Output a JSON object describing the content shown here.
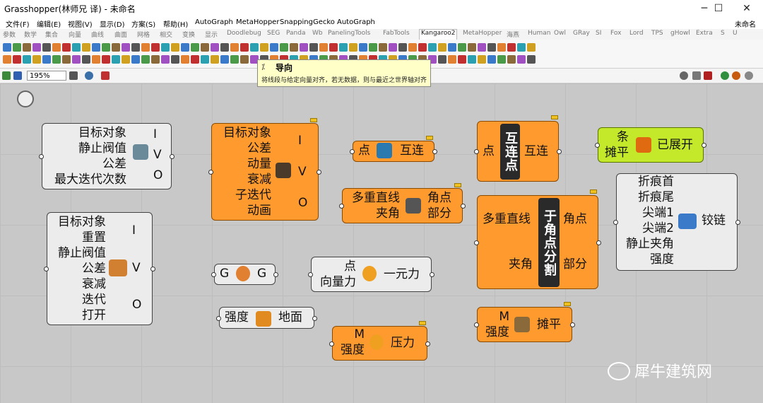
{
  "window": {
    "title": "Grasshopper(林师兄 译) - 未命名",
    "minimize": "─",
    "maximize": "☐",
    "close": "✕",
    "doc_name": "未命名"
  },
  "menu": [
    "文件(F)",
    "编辑(E)",
    "视图(V)",
    "显示(D)",
    "方案(S)",
    "帮助(H)",
    "AutoGraph",
    "MetaHopper",
    "SnappingGecko",
    "AutoGraph"
  ],
  "tabs": [
    "参数",
    "数学",
    "集合",
    "向量",
    "曲线",
    "曲面",
    "网格",
    "相交",
    "变换",
    "显示",
    "Doodlebug",
    "SEG",
    "Panda",
    "Wb",
    "PanelingTools",
    "FabTools",
    "Kangaroo2",
    "MetaHopper",
    "海燕",
    "Human",
    "Owl",
    "GRay",
    "SI",
    "Fox",
    "Lord",
    "TPS",
    "gHowl",
    "Extra",
    "S",
    "U"
  ],
  "active_tab": "Kangaroo2",
  "zoom": "195%",
  "tooltip": {
    "icon": "⁒",
    "title": "导向",
    "description": "将线段与给定向量对齐，若无数据，则与最近之世界轴对齐"
  },
  "components": {
    "c1": {
      "inputs": [
        "目标对象",
        "静止阀值",
        "公差",
        "最大迭代次数"
      ],
      "outputs": [
        "I",
        "V",
        "O"
      ]
    },
    "c2": {
      "inputs": [
        "目标对象",
        "公差",
        "动量",
        "衰减",
        "子迭代",
        "动画"
      ],
      "outputs": [
        "I",
        "V",
        "O"
      ]
    },
    "c3": {
      "input": "点",
      "output": "互连"
    },
    "c4": {
      "input": "点",
      "band": "互连点",
      "output": "互连"
    },
    "c5": {
      "inputs": [
        "条",
        "摊平"
      ],
      "output": "已展开"
    },
    "c6": {
      "inputs": [
        "目标对象",
        "重置",
        "静止阀值",
        "公差",
        "衰减",
        "迭代",
        "打开"
      ],
      "outputs": [
        "I",
        "V",
        "O"
      ]
    },
    "c7": {
      "inputs": [
        "多重直线",
        "夹角"
      ],
      "outputs": [
        "角点",
        "部分"
      ]
    },
    "c8": {
      "inputs": [
        "多重直线",
        "夹角"
      ],
      "band": "于角点分割",
      "outputs": [
        "角点",
        "部分"
      ]
    },
    "c9": {
      "inputs": [
        "折痕首",
        "折痕尾",
        "尖端1",
        "尖端2",
        "静止夹角",
        "强度"
      ],
      "output": "铰链"
    },
    "c10": {
      "input": "G",
      "output": "G"
    },
    "c11": {
      "inputs": [
        "点",
        "向量力"
      ],
      "output": "一元力"
    },
    "c12": {
      "input": "强度",
      "output": "地面"
    },
    "c13": {
      "inputs": [
        "M",
        "强度"
      ],
      "output": "压力"
    },
    "c14": {
      "inputs": [
        "M",
        "强度"
      ],
      "output": "摊平"
    }
  },
  "watermark": "犀牛建筑网",
  "colors": {
    "orange": "#ff9a2e",
    "grey": "#ececec",
    "green": "#c4e82a",
    "tooltip": "#ffffc8"
  }
}
